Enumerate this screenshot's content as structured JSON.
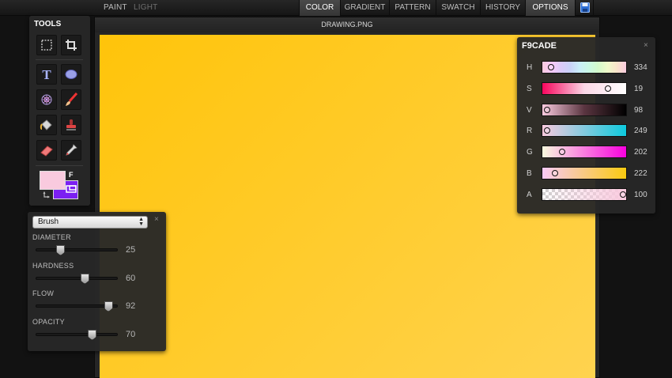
{
  "menu": {
    "left": [
      {
        "label": "PAINT",
        "color": "#bdbdbd"
      },
      {
        "label": "LIGHT",
        "color": "#6f6f6f"
      }
    ],
    "tabs": [
      "COLOR",
      "GRADIENT",
      "PATTERN",
      "SWATCH",
      "HISTORY",
      "OPTIONS"
    ],
    "active_tabs": [
      "COLOR",
      "OPTIONS"
    ],
    "save_icon": "floppy-disk-icon"
  },
  "document": {
    "title": "DRAWING.PNG",
    "canvas_colors": [
      "#ffc40a",
      "#ffd34f"
    ]
  },
  "tools": {
    "title": "TOOLS",
    "items": [
      {
        "name": "marquee-select-icon",
        "label": "Selection"
      },
      {
        "name": "crop-icon",
        "label": "Crop"
      },
      {
        "name": "text-icon",
        "label": "Text"
      },
      {
        "name": "ellipse-icon",
        "label": "Ellipse"
      },
      {
        "name": "spirograph-icon",
        "label": "Spirograph"
      },
      {
        "name": "brush-icon",
        "label": "Brush"
      },
      {
        "name": "fill-bucket-icon",
        "label": "Fill"
      },
      {
        "name": "stamp-icon",
        "label": "Stamp"
      },
      {
        "name": "eraser-icon",
        "label": "Eraser"
      },
      {
        "name": "eyedropper-icon",
        "label": "Picker"
      }
    ],
    "fill_label": "F",
    "foreground_color": "#f9cade",
    "background_color": "#7b1ff2"
  },
  "brush_panel": {
    "selected": "Brush",
    "close": "×",
    "sliders": [
      {
        "label": "DIAMETER",
        "value": 25,
        "fraction": 0.27
      },
      {
        "label": "HARDNESS",
        "value": 60,
        "fraction": 0.6
      },
      {
        "label": "FLOW",
        "value": 92,
        "fraction": 0.92
      },
      {
        "label": "OPACITY",
        "value": 70,
        "fraction": 0.7
      }
    ]
  },
  "color_panel": {
    "title": "F9CADE",
    "close": "×",
    "channels": [
      {
        "label": "H",
        "value": 334,
        "fraction": 0.07,
        "gradient": "linear-gradient(to right,#f9cade,#f9cafa,#dccaf9,#cad3f9,#caeff9,#caf9e4,#d3f9ca,#eff9ca,#f9e4ca,#f9cade)"
      },
      {
        "label": "S",
        "value": 19,
        "fraction": 0.81,
        "gradient": "linear-gradient(to right,#f9065d,#fbd8e6,#ffffff)"
      },
      {
        "label": "V",
        "value": 98,
        "fraction": 0.02,
        "gradient": "linear-gradient(to right,#f9cade,#5a3540,#000000)"
      },
      {
        "label": "R",
        "value": 249,
        "fraction": 0.02,
        "gradient": "linear-gradient(to right,#f9cade,#0dcade)"
      },
      {
        "label": "G",
        "value": 202,
        "fraction": 0.21,
        "gradient": "linear-gradient(to right,#f9fade,#f900de)"
      },
      {
        "label": "B",
        "value": 222,
        "fraction": 0.12,
        "gradient": "linear-gradient(to right,#f9caf6,#f9ca10)"
      },
      {
        "label": "A",
        "value": 100,
        "fraction": 1.0,
        "gradient": "linear-gradient(to right,rgba(249,202,222,0),rgba(249,202,222,1))"
      }
    ]
  }
}
